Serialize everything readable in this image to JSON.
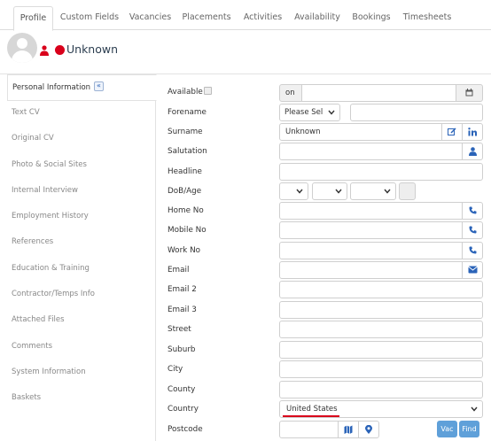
{
  "tabs": [
    {
      "label": "Profile",
      "active": true
    },
    {
      "label": "Custom Fields"
    },
    {
      "label": "Vacancies"
    },
    {
      "label": "Placements"
    },
    {
      "label": "Activities"
    },
    {
      "label": "Availability"
    },
    {
      "label": "Bookings"
    },
    {
      "label": "Timesheets"
    }
  ],
  "header": {
    "name": "Unknown",
    "status_color": "#d9001b"
  },
  "sidebar": {
    "collapse_glyph": "«",
    "items": [
      {
        "label": "Personal Information"
      },
      {
        "label": "Text CV"
      },
      {
        "label": "Original CV"
      },
      {
        "label": "Photo & Social Sites"
      },
      {
        "label": "Internal Interview"
      },
      {
        "label": "Employment History"
      },
      {
        "label": "References"
      },
      {
        "label": "Education & Training"
      },
      {
        "label": "Contractor/Temps Info"
      },
      {
        "label": "Attached Files"
      },
      {
        "label": "Comments"
      },
      {
        "label": "System Information"
      },
      {
        "label": "Baskets"
      }
    ]
  },
  "form": {
    "available": {
      "label": "Available",
      "value": "on"
    },
    "forename": {
      "label": "Forename",
      "title_value": "Please Sel",
      "value": ""
    },
    "surname": {
      "label": "Surname",
      "value": "Unknown"
    },
    "salutation": {
      "label": "Salutation",
      "value": ""
    },
    "headline": {
      "label": "Headline",
      "value": ""
    },
    "dob": {
      "label": "DoB/Age"
    },
    "home_no": {
      "label": "Home No"
    },
    "mobile_no": {
      "label": "Mobile No"
    },
    "work_no": {
      "label": "Work No"
    },
    "email": {
      "label": "Email"
    },
    "email2": {
      "label": "Email 2"
    },
    "email3": {
      "label": "Email 3"
    },
    "street": {
      "label": "Street"
    },
    "suburb": {
      "label": "Suburb"
    },
    "city": {
      "label": "City"
    },
    "county": {
      "label": "County"
    },
    "country": {
      "label": "Country",
      "value": "United States"
    },
    "postcode": {
      "label": "Postcode",
      "vac_label": "Vac",
      "find_label": "Find"
    }
  },
  "colors": {
    "accent": "#2a63b8",
    "button": "#5fa0d9",
    "underline": "#d9001b"
  }
}
